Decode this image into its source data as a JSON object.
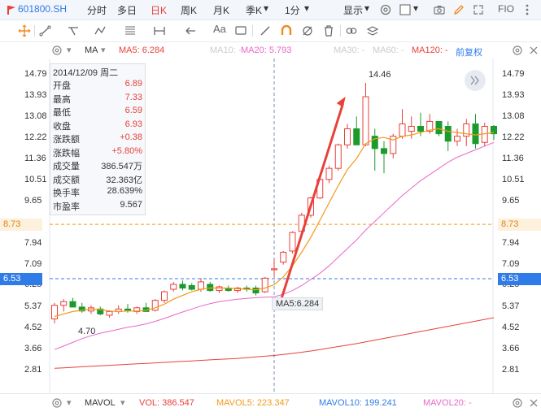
{
  "toolbar": {
    "symbol": "601800.SH",
    "tabs": [
      "分时",
      "多日",
      "日K",
      "周K",
      "月K",
      "季K",
      "1分"
    ],
    "active_tab": "日K",
    "display_label": "显示",
    "fio_label": "FIO"
  },
  "ma_legend": {
    "label": "MA",
    "ma5": "MA5: 6.284",
    "ma10": "MA10: -",
    "ma20": "MA20: 5.793",
    "ma30": "MA30: -",
    "ma60": "MA60: -",
    "ma120": "MA120: -",
    "adjust": "前复权"
  },
  "y_axis_left": [
    "14.79",
    "13.93",
    "13.08",
    "12.22",
    "11.36",
    "10.51",
    "9.65",
    "8.73",
    "7.94",
    "7.09",
    "6.53",
    "6.25",
    "5.37",
    "4.52",
    "3.66",
    "2.81"
  ],
  "y_axis_right": [
    "14.79",
    "13.93",
    "13.08",
    "12.22",
    "11.36",
    "10.51",
    "9.65",
    "8.73",
    "7.94",
    "7.09",
    "6.53",
    "6.25",
    "5.37",
    "4.52",
    "3.66",
    "2.81"
  ],
  "price_tags": {
    "orange": "8.73",
    "blue": "6.53"
  },
  "annotations": {
    "high": "14.46",
    "low": "4.70",
    "ma5_tip": "MA5:6.284"
  },
  "info": {
    "date": "2014/12/09 周二",
    "rows": [
      {
        "k": "开盘",
        "v": "6.89",
        "c": "#e8413a"
      },
      {
        "k": "最高",
        "v": "7.33",
        "c": "#e8413a"
      },
      {
        "k": "最低",
        "v": "6.59",
        "c": "#e8413a"
      },
      {
        "k": "收盘",
        "v": "6.93",
        "c": "#e8413a"
      },
      {
        "k": "涨跌额",
        "v": "+0.38",
        "c": "#e8413a"
      },
      {
        "k": "涨跌幅",
        "v": "+5.80%",
        "c": "#e8413a"
      },
      {
        "k": "成交量",
        "v": "386.547万",
        "c": "#333333"
      },
      {
        "k": "成交额",
        "v": "32.363亿",
        "c": "#333333"
      },
      {
        "k": "换手率",
        "v": "28.639%",
        "c": "#333333"
      },
      {
        "k": "市盈率",
        "v": "9.567",
        "c": "#333333"
      }
    ]
  },
  "volume_legend": {
    "label": "MAVOL",
    "vol": "VOL: 386.547",
    "mavol5": "MAVOL5: 223.347",
    "mavol10": "MAVOL10: 199.241",
    "mavol20": "MAVOL20: -"
  },
  "colors": {
    "up": "#e8413a",
    "down": "#1b9b2c",
    "ma5": "#f29a1a",
    "ma20": "#e868c8",
    "ma_long": "#e8413a",
    "accent": "#2f7be8"
  },
  "chart_data": {
    "type": "candlestick",
    "ylim": [
      2.81,
      14.79
    ],
    "candles": [
      {
        "o": 4.9,
        "h": 5.55,
        "l": 4.72,
        "c": 5.45
      },
      {
        "o": 5.45,
        "h": 5.7,
        "l": 5.2,
        "c": 5.6
      },
      {
        "o": 5.6,
        "h": 5.75,
        "l": 5.4,
        "c": 5.38
      },
      {
        "o": 5.38,
        "h": 5.55,
        "l": 5.15,
        "c": 5.22
      },
      {
        "o": 5.22,
        "h": 5.45,
        "l": 5.1,
        "c": 5.35
      },
      {
        "o": 5.3,
        "h": 5.4,
        "l": 5.05,
        "c": 5.1
      },
      {
        "o": 5.05,
        "h": 5.25,
        "l": 4.95,
        "c": 5.2
      },
      {
        "o": 5.2,
        "h": 5.45,
        "l": 5.1,
        "c": 5.3
      },
      {
        "o": 5.3,
        "h": 5.5,
        "l": 5.15,
        "c": 5.25
      },
      {
        "o": 5.2,
        "h": 5.4,
        "l": 5.1,
        "c": 5.35
      },
      {
        "o": 5.35,
        "h": 5.55,
        "l": 5.2,
        "c": 5.2
      },
      {
        "o": 5.25,
        "h": 5.7,
        "l": 5.2,
        "c": 5.65
      },
      {
        "o": 5.65,
        "h": 6.05,
        "l": 5.55,
        "c": 6.0
      },
      {
        "o": 6.1,
        "h": 6.4,
        "l": 6.0,
        "c": 6.3
      },
      {
        "o": 6.3,
        "h": 6.45,
        "l": 6.05,
        "c": 6.15
      },
      {
        "o": 6.25,
        "h": 6.35,
        "l": 6.05,
        "c": 6.1
      },
      {
        "o": 6.1,
        "h": 6.55,
        "l": 6.0,
        "c": 6.4
      },
      {
        "o": 6.3,
        "h": 6.4,
        "l": 6.0,
        "c": 6.05
      },
      {
        "o": 6.05,
        "h": 6.25,
        "l": 5.95,
        "c": 6.2
      },
      {
        "o": 6.15,
        "h": 6.25,
        "l": 6.0,
        "c": 6.05
      },
      {
        "o": 6.05,
        "h": 6.2,
        "l": 5.95,
        "c": 6.15
      },
      {
        "o": 6.15,
        "h": 6.25,
        "l": 6.0,
        "c": 6.1
      },
      {
        "o": 6.15,
        "h": 6.25,
        "l": 5.85,
        "c": 5.95
      },
      {
        "o": 6.0,
        "h": 6.6,
        "l": 5.95,
        "c": 6.55
      },
      {
        "o": 6.89,
        "h": 7.33,
        "l": 6.59,
        "c": 6.93
      },
      {
        "o": 7.2,
        "h": 7.65,
        "l": 7.1,
        "c": 7.6
      },
      {
        "o": 7.65,
        "h": 8.45,
        "l": 7.55,
        "c": 8.4
      },
      {
        "o": 8.45,
        "h": 9.2,
        "l": 8.4,
        "c": 9.1
      },
      {
        "o": 9.1,
        "h": 9.85,
        "l": 9.0,
        "c": 9.8
      },
      {
        "o": 9.8,
        "h": 10.7,
        "l": 9.75,
        "c": 10.55
      },
      {
        "o": 10.55,
        "h": 11.1,
        "l": 10.4,
        "c": 11.0
      },
      {
        "o": 11.0,
        "h": 12.0,
        "l": 10.9,
        "c": 11.95
      },
      {
        "o": 11.95,
        "h": 12.8,
        "l": 11.8,
        "c": 12.6
      },
      {
        "o": 12.6,
        "h": 13.1,
        "l": 12.2,
        "c": 11.95
      },
      {
        "o": 11.95,
        "h": 14.46,
        "l": 11.9,
        "c": 13.9
      },
      {
        "o": 12.3,
        "h": 12.6,
        "l": 10.9,
        "c": 11.8
      },
      {
        "o": 11.8,
        "h": 12.1,
        "l": 10.8,
        "c": 11.6
      },
      {
        "o": 11.6,
        "h": 12.4,
        "l": 11.4,
        "c": 12.3
      },
      {
        "o": 12.3,
        "h": 13.4,
        "l": 12.2,
        "c": 12.8
      },
      {
        "o": 12.5,
        "h": 13.1,
        "l": 12.2,
        "c": 12.7
      },
      {
        "o": 12.7,
        "h": 13.25,
        "l": 12.3,
        "c": 12.5
      },
      {
        "o": 12.5,
        "h": 13.2,
        "l": 12.4,
        "c": 12.9
      },
      {
        "o": 12.9,
        "h": 12.9,
        "l": 12.3,
        "c": 12.4
      },
      {
        "o": 12.7,
        "h": 12.9,
        "l": 11.7,
        "c": 12.1
      },
      {
        "o": 12.1,
        "h": 12.6,
        "l": 11.9,
        "c": 12.3
      },
      {
        "o": 12.3,
        "h": 13.0,
        "l": 11.9,
        "c": 12.8
      },
      {
        "o": 12.8,
        "h": 13.2,
        "l": 11.8,
        "c": 12.0
      },
      {
        "o": 12.05,
        "h": 12.85,
        "l": 11.9,
        "c": 12.7
      },
      {
        "o": 12.7,
        "h": 12.75,
        "l": 12.15,
        "c": 12.4
      }
    ],
    "ma5": [
      5.0,
      5.1,
      5.2,
      5.25,
      5.3,
      5.28,
      5.22,
      5.2,
      5.22,
      5.22,
      5.25,
      5.35,
      5.5,
      5.7,
      5.85,
      6.0,
      6.1,
      6.15,
      6.15,
      6.15,
      6.12,
      6.1,
      6.08,
      6.15,
      6.284,
      6.6,
      7.05,
      7.6,
      8.2,
      8.9,
      9.6,
      10.3,
      10.95,
      11.4,
      12.0,
      12.2,
      12.25,
      12.15,
      12.3,
      12.35,
      12.45,
      12.55,
      12.6,
      12.5,
      12.45,
      12.4,
      12.35,
      12.4,
      12.45
    ],
    "ma20": [
      3.66,
      3.8,
      3.95,
      4.1,
      4.22,
      4.32,
      4.4,
      4.48,
      4.56,
      4.62,
      4.7,
      4.8,
      4.92,
      5.05,
      5.18,
      5.3,
      5.42,
      5.52,
      5.6,
      5.65,
      5.7,
      5.73,
      5.76,
      5.78,
      5.793,
      5.9,
      6.05,
      6.25,
      6.5,
      6.75,
      7.05,
      7.4,
      7.75,
      8.1,
      8.5,
      8.85,
      9.2,
      9.55,
      9.9,
      10.2,
      10.5,
      10.75,
      11.0,
      11.25,
      11.45,
      11.6,
      11.75,
      11.9,
      12.05
    ],
    "ma_long": [
      2.9,
      2.92,
      2.94,
      2.96,
      2.98,
      3.0,
      3.02,
      3.04,
      3.06,
      3.08,
      3.1,
      3.12,
      3.14,
      3.16,
      3.18,
      3.2,
      3.22,
      3.24,
      3.26,
      3.28,
      3.3,
      3.33,
      3.36,
      3.39,
      3.42,
      3.46,
      3.5,
      3.55,
      3.6,
      3.66,
      3.72,
      3.78,
      3.84,
      3.9,
      3.97,
      4.04,
      4.11,
      4.18,
      4.25,
      4.32,
      4.39,
      4.46,
      4.53,
      4.6,
      4.67,
      4.74,
      4.81,
      4.88,
      4.95
    ]
  }
}
